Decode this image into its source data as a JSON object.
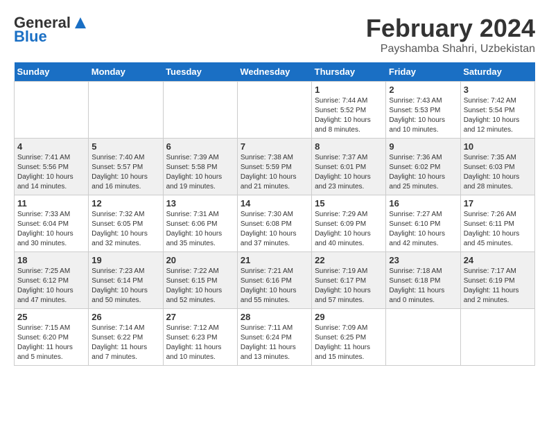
{
  "header": {
    "logo_general": "General",
    "logo_blue": "Blue",
    "month": "February 2024",
    "location": "Payshamba Shahri, Uzbekistan"
  },
  "days_of_week": [
    "Sunday",
    "Monday",
    "Tuesday",
    "Wednesday",
    "Thursday",
    "Friday",
    "Saturday"
  ],
  "weeks": [
    [
      {
        "day": "",
        "info": ""
      },
      {
        "day": "",
        "info": ""
      },
      {
        "day": "",
        "info": ""
      },
      {
        "day": "",
        "info": ""
      },
      {
        "day": "1",
        "info": "Sunrise: 7:44 AM\nSunset: 5:52 PM\nDaylight: 10 hours\nand 8 minutes."
      },
      {
        "day": "2",
        "info": "Sunrise: 7:43 AM\nSunset: 5:53 PM\nDaylight: 10 hours\nand 10 minutes."
      },
      {
        "day": "3",
        "info": "Sunrise: 7:42 AM\nSunset: 5:54 PM\nDaylight: 10 hours\nand 12 minutes."
      }
    ],
    [
      {
        "day": "4",
        "info": "Sunrise: 7:41 AM\nSunset: 5:56 PM\nDaylight: 10 hours\nand 14 minutes."
      },
      {
        "day": "5",
        "info": "Sunrise: 7:40 AM\nSunset: 5:57 PM\nDaylight: 10 hours\nand 16 minutes."
      },
      {
        "day": "6",
        "info": "Sunrise: 7:39 AM\nSunset: 5:58 PM\nDaylight: 10 hours\nand 19 minutes."
      },
      {
        "day": "7",
        "info": "Sunrise: 7:38 AM\nSunset: 5:59 PM\nDaylight: 10 hours\nand 21 minutes."
      },
      {
        "day": "8",
        "info": "Sunrise: 7:37 AM\nSunset: 6:01 PM\nDaylight: 10 hours\nand 23 minutes."
      },
      {
        "day": "9",
        "info": "Sunrise: 7:36 AM\nSunset: 6:02 PM\nDaylight: 10 hours\nand 25 minutes."
      },
      {
        "day": "10",
        "info": "Sunrise: 7:35 AM\nSunset: 6:03 PM\nDaylight: 10 hours\nand 28 minutes."
      }
    ],
    [
      {
        "day": "11",
        "info": "Sunrise: 7:33 AM\nSunset: 6:04 PM\nDaylight: 10 hours\nand 30 minutes."
      },
      {
        "day": "12",
        "info": "Sunrise: 7:32 AM\nSunset: 6:05 PM\nDaylight: 10 hours\nand 32 minutes."
      },
      {
        "day": "13",
        "info": "Sunrise: 7:31 AM\nSunset: 6:06 PM\nDaylight: 10 hours\nand 35 minutes."
      },
      {
        "day": "14",
        "info": "Sunrise: 7:30 AM\nSunset: 6:08 PM\nDaylight: 10 hours\nand 37 minutes."
      },
      {
        "day": "15",
        "info": "Sunrise: 7:29 AM\nSunset: 6:09 PM\nDaylight: 10 hours\nand 40 minutes."
      },
      {
        "day": "16",
        "info": "Sunrise: 7:27 AM\nSunset: 6:10 PM\nDaylight: 10 hours\nand 42 minutes."
      },
      {
        "day": "17",
        "info": "Sunrise: 7:26 AM\nSunset: 6:11 PM\nDaylight: 10 hours\nand 45 minutes."
      }
    ],
    [
      {
        "day": "18",
        "info": "Sunrise: 7:25 AM\nSunset: 6:12 PM\nDaylight: 10 hours\nand 47 minutes."
      },
      {
        "day": "19",
        "info": "Sunrise: 7:23 AM\nSunset: 6:14 PM\nDaylight: 10 hours\nand 50 minutes."
      },
      {
        "day": "20",
        "info": "Sunrise: 7:22 AM\nSunset: 6:15 PM\nDaylight: 10 hours\nand 52 minutes."
      },
      {
        "day": "21",
        "info": "Sunrise: 7:21 AM\nSunset: 6:16 PM\nDaylight: 10 hours\nand 55 minutes."
      },
      {
        "day": "22",
        "info": "Sunrise: 7:19 AM\nSunset: 6:17 PM\nDaylight: 10 hours\nand 57 minutes."
      },
      {
        "day": "23",
        "info": "Sunrise: 7:18 AM\nSunset: 6:18 PM\nDaylight: 11 hours\nand 0 minutes."
      },
      {
        "day": "24",
        "info": "Sunrise: 7:17 AM\nSunset: 6:19 PM\nDaylight: 11 hours\nand 2 minutes."
      }
    ],
    [
      {
        "day": "25",
        "info": "Sunrise: 7:15 AM\nSunset: 6:20 PM\nDaylight: 11 hours\nand 5 minutes."
      },
      {
        "day": "26",
        "info": "Sunrise: 7:14 AM\nSunset: 6:22 PM\nDaylight: 11 hours\nand 7 minutes."
      },
      {
        "day": "27",
        "info": "Sunrise: 7:12 AM\nSunset: 6:23 PM\nDaylight: 11 hours\nand 10 minutes."
      },
      {
        "day": "28",
        "info": "Sunrise: 7:11 AM\nSunset: 6:24 PM\nDaylight: 11 hours\nand 13 minutes."
      },
      {
        "day": "29",
        "info": "Sunrise: 7:09 AM\nSunset: 6:25 PM\nDaylight: 11 hours\nand 15 minutes."
      },
      {
        "day": "",
        "info": ""
      },
      {
        "day": "",
        "info": ""
      }
    ]
  ]
}
